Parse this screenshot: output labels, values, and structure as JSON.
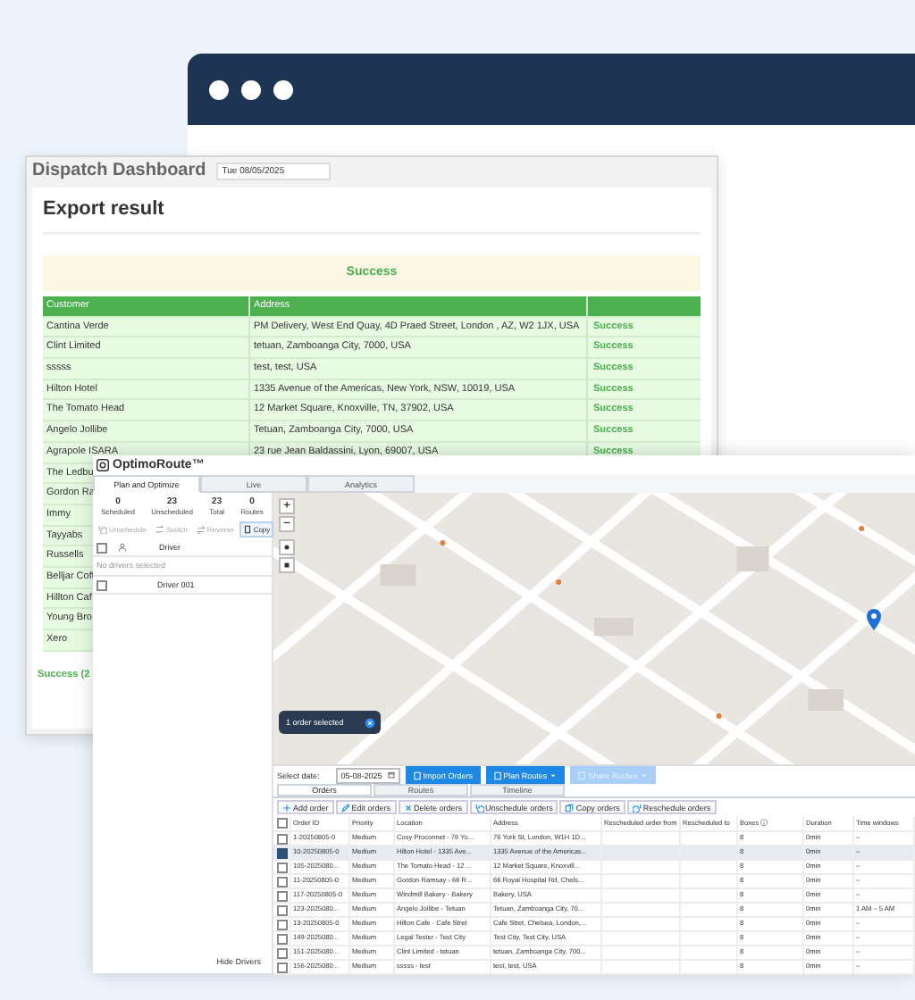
{
  "dispatch": {
    "title": "Dispatch Dashboard",
    "date": "Tue 08/05/2025",
    "heading": "Export result",
    "banner": "Success",
    "columns": [
      "Customer",
      "Address"
    ],
    "rows": [
      {
        "customer": "Cantina Verde",
        "address": "PM Delivery, West End Quay, 4D Praed Street, London , AZ, W2 1JX, USA",
        "status": "Success"
      },
      {
        "customer": "Clint Limited",
        "address": "tetuan, Zamboanga City, 7000, USA",
        "status": "Success"
      },
      {
        "customer": "sssss",
        "address": "test, test, USA",
        "status": "Success"
      },
      {
        "customer": "Hilton Hotel",
        "address": "1335 Avenue of the Americas, New York, NSW, 10019, USA",
        "status": "Success"
      },
      {
        "customer": "The Tomato Head",
        "address": "12 Market Square, Knoxville, TN, 37902, USA",
        "status": "Success"
      },
      {
        "customer": "Angelo Jollibe",
        "address": "Tetuan, Zamboanga City, 7000, USA",
        "status": "Success"
      },
      {
        "customer": "Agrapole ISARA",
        "address": "23 rue Jean Baldassini, Lyon, 69007, USA",
        "status": "Success"
      },
      {
        "customer": "The Ledbu"
      },
      {
        "customer": "Gordon Ra"
      },
      {
        "customer": "Immy"
      },
      {
        "customer": "Tayyabs"
      },
      {
        "customer": "Russells"
      },
      {
        "customer": "Belljar Coff"
      },
      {
        "customer": "Hillton Caf"
      },
      {
        "customer": "Young Bro"
      },
      {
        "customer": "Xero"
      }
    ],
    "footer": "Success (2"
  },
  "optimo": {
    "logo": "OptimoRoute™",
    "tabs": [
      {
        "label": "Plan and Optimize",
        "selected": true
      },
      {
        "label": "Live",
        "selected": false
      },
      {
        "label": "Analytics",
        "selected": false
      }
    ],
    "stats": [
      {
        "value": "0",
        "label": "Scheduled"
      },
      {
        "value": "23",
        "label": "Unscheduled"
      },
      {
        "value": "23",
        "label": "Total"
      },
      {
        "value": "0",
        "label": "Routes"
      }
    ],
    "tools": [
      {
        "label": "Unschedule",
        "disabled": true
      },
      {
        "label": "Switch",
        "disabled": true
      },
      {
        "label": "Reverse",
        "disabled": true
      },
      {
        "label": "Copy",
        "disabled": false
      }
    ],
    "drivers_all_checked": false,
    "orders_all_checked": false,
    "driver_column": "Driver",
    "empty_note": "No drivers selected",
    "drivers": [
      {
        "name": "Driver 001",
        "checked": false
      }
    ],
    "hide_drivers": "Hide Drivers",
    "map": {
      "zoom_in": "+",
      "zoom_out": "−",
      "selection": "1 order selected"
    },
    "date_label": "Select date:",
    "date": "05-08-2025",
    "actions": [
      {
        "label": "Import Orders",
        "disabled": false,
        "dropdown": false
      },
      {
        "label": "Plan Routes",
        "disabled": false,
        "dropdown": true
      },
      {
        "label": "Share Routes",
        "disabled": true,
        "dropdown": true
      }
    ],
    "order_tabs": [
      {
        "label": "Orders",
        "selected": true
      },
      {
        "label": "Routes",
        "selected": false
      },
      {
        "label": "Timeline",
        "selected": false
      }
    ],
    "order_actions": [
      "Add order",
      "Edit orders",
      "Delete orders",
      "Unschedule orders",
      "Copy orders",
      "Reschedule orders"
    ],
    "columns": [
      "Order ID",
      "Priority",
      "Location",
      "Address",
      "Rescheduled order from",
      "Rescheduled to",
      "Boxes ⓘ",
      "Duration",
      "Time windows"
    ],
    "orders": [
      {
        "id": "1-20250805-0",
        "priority": "Medium",
        "location": "Cosy Proconnet - 76 Yo...",
        "address": "76 York St, London, W1H 1D...",
        "boxes": "8",
        "duration": "0min",
        "time_window": "–",
        "selected": false
      },
      {
        "id": "10-20250805-0",
        "priority": "Medium",
        "location": "Hilton Hotel - 1335 Ave...",
        "address": "1335 Avenue of the Americas...",
        "boxes": "8",
        "duration": "0min",
        "time_window": "–",
        "selected": true
      },
      {
        "id": "105-2025080...",
        "priority": "Medium",
        "location": "The Tomato Head - 12 ...",
        "address": "12 Market Square, Knoxvill...",
        "boxes": "8",
        "duration": "0min",
        "time_window": "–",
        "selected": false
      },
      {
        "id": "11-20250805-0",
        "priority": "Medium",
        "location": "Gordon Ramsay - 66 R...",
        "address": "66 Royal Hospital Rd, Chels...",
        "boxes": "8",
        "duration": "0min",
        "time_window": "–",
        "selected": false
      },
      {
        "id": "117-20250805-0",
        "priority": "Medium",
        "location": "Windmill Bakery - Bakery",
        "address": "Bakery, USA",
        "boxes": "8",
        "duration": "0min",
        "time_window": "–",
        "selected": false
      },
      {
        "id": "123-2025080...",
        "priority": "Medium",
        "location": "Angelo Jollibe - Tetuan",
        "address": "Tetuan, Zamboanga City, 70...",
        "boxes": "8",
        "duration": "0min",
        "time_window": "1 AM – 5 AM",
        "selected": false
      },
      {
        "id": "13-20250805-0",
        "priority": "Medium",
        "location": "Hilton Cafe - Cafe Stret",
        "address": "Cafe Stret, Chelsea, London,...",
        "boxes": "8",
        "duration": "0min",
        "time_window": "–",
        "selected": false
      },
      {
        "id": "149-2025080...",
        "priority": "Medium",
        "location": "Legal Tester - Test City",
        "address": "Test City, Test City, USA",
        "boxes": "8",
        "duration": "0min",
        "time_window": "–",
        "selected": false
      },
      {
        "id": "151-2025080...",
        "priority": "Medium",
        "location": "Clint Limited - tetuan",
        "address": "tetuan, Zamboanga City, 700...",
        "boxes": "8",
        "duration": "0min",
        "time_window": "–",
        "selected": false
      },
      {
        "id": "156-2025080...",
        "priority": "Medium",
        "location": "sssss - test",
        "address": "test, test, USA",
        "boxes": "8",
        "duration": "0min",
        "time_window": "–",
        "selected": false
      }
    ]
  }
}
